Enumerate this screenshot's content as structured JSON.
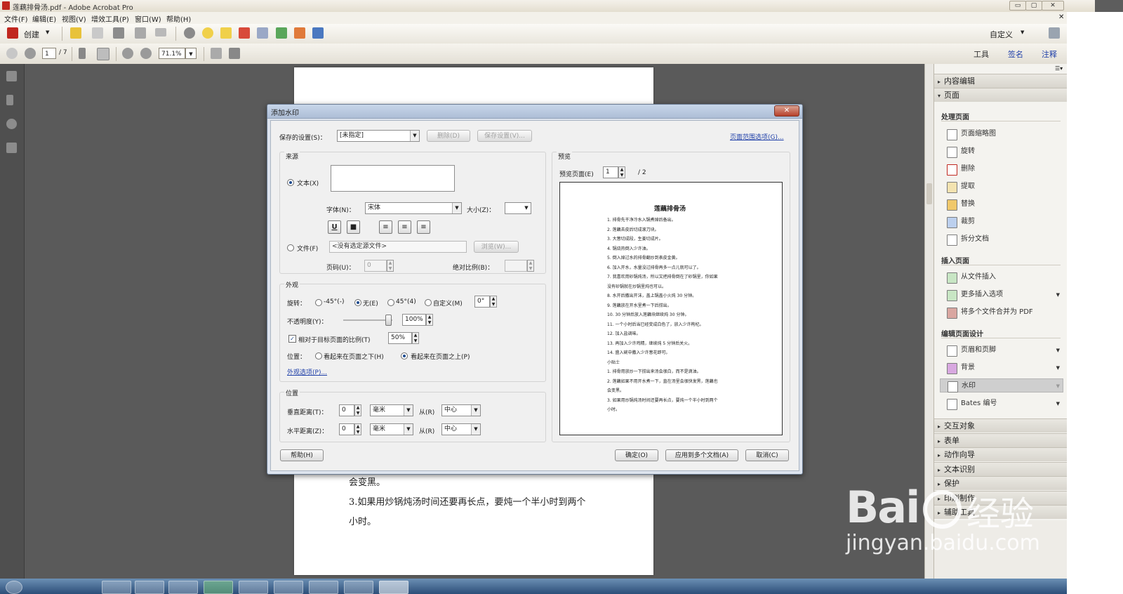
{
  "window": {
    "title": "莲藕排骨汤.pdf - Adobe Acrobat Pro",
    "min": "▭",
    "max": "▢",
    "close": "✕",
    "doc_close": "✕"
  },
  "menu": [
    "文件(F)",
    "编辑(E)",
    "视图(V)",
    "增效工具(P)",
    "窗口(W)",
    "帮助(H)"
  ],
  "toolbar": {
    "create": "创建",
    "customize": "自定义"
  },
  "nav": {
    "page": "1",
    "total": "/ 7",
    "zoom": "71.1%"
  },
  "right_links": {
    "tools": "工具",
    "sign": "签名",
    "comment": "注释"
  },
  "document": {
    "lines": [
      "会变黑。",
      "3.如果用炒锅炖汤时间还要再长点，要炖一个半小时到两个",
      "小时。"
    ]
  },
  "panel": {
    "content_edit": "内容编辑",
    "pages": "页面",
    "process_pages": "处理页面",
    "process_items": [
      "页面缩略图",
      "旋转",
      "删除",
      "提取",
      "替换",
      "裁剪",
      "拆分文档"
    ],
    "insert_pages": "插入页面",
    "insert_items": [
      "从文件插入",
      "更多插入选项",
      "将多个文件合并为 PDF"
    ],
    "design": "编辑页面设计",
    "design_items": [
      "页眉和页脚",
      "背景",
      "水印",
      "Bates 编号"
    ],
    "sections": [
      "交互对象",
      "表单",
      "动作向导",
      "文本识别",
      "保护",
      "印刷制作",
      "辅助工具"
    ]
  },
  "dialog": {
    "title": "添加水印",
    "saved_settings_label": "保存的设置(S)：",
    "saved_settings_value": "[未指定]",
    "delete_btn": "删除(D)",
    "save_settings_btn": "保存设置(V)...",
    "page_range_link": "页面范围选项(G)...",
    "source": {
      "title": "来源",
      "text_label": "文本(X)",
      "font_label": "字体(N)：",
      "font_value": "宋体",
      "size_label": "大小(Z)：",
      "underline": "U",
      "color": "■",
      "align": [
        "≡",
        "≡",
        "≡"
      ],
      "file_label": "文件(F)",
      "file_value": "<没有选定源文件>",
      "browse_btn": "浏览(W)...",
      "page_num_label": "页码(U)：",
      "page_num_value": "0",
      "abs_scale_label": "绝对比例(B)："
    },
    "appearance": {
      "title": "外观",
      "rotation_label": "旋转：",
      "rot_options": [
        "-45°(-)",
        "无(E)",
        "45°(4)",
        "自定义(M)"
      ],
      "rot_custom": "0°",
      "opacity_label": "不透明度(Y)：",
      "opacity_value": "100%",
      "relative_label": "相对于目标页面的比例(T)",
      "relative_value": "50%",
      "position_label": "位置：",
      "pos_behind": "看起来在页面之下(H)",
      "pos_front": "看起来在页面之上(P)",
      "options_link": "外观选项(P)..."
    },
    "position": {
      "title": "位置",
      "vdist_label": "垂直距离(T)：",
      "vdist_value": "0",
      "hdist_label": "水平距离(Z)：",
      "hdist_value": "0",
      "unit": "毫米",
      "from_label": "从(R)",
      "from_value": "中心"
    },
    "preview": {
      "title": "预览",
      "page_label": "预览页面(E)",
      "page_value": "1",
      "total": "/ 2",
      "doc_title": "莲藕排骨汤",
      "lines": [
        "1. 排骨先干净冷水入锅煮焯后备出。",
        "2. 莲藕去皮后切成滚刀块。",
        "3. 大葱切成段，生姜切成片。",
        "4. 锅烧热倒入少许油。",
        "5. 倒入焯过水的排骨翻炒到表皮金黄。",
        "6. 加入开水，水量没过排骨再多一点儿就可以了。",
        "7. 我喜欢用砂锅炖汤，所以又把排骨倒在了砂锅里，你如果",
        "没有砂锅就在炒锅里炖也可以。",
        "8. 水开后撒出开沫，盖上锅盖小火炖 30 分钟。",
        "9. 莲藕放在开水里煮一下后捞出。",
        "10. 30 分钟后放入莲藕块继续炖 30 分钟。",
        "11. 一个小时后当已经变成白色了，放入少许枸杞。",
        "12. 加入盐调味。",
        "13. 再加入少许鸡精，继续炖 5 分钟后关火。",
        "14. 盛入碗中撒入少许葱花即可。",
        "小贴士",
        "1. 排骨用放炒一下捞出来汤会很白，而不是滴油。",
        "2. 莲藕如果不用开水煮一下，直在汤里会很快发黑，莲藕也",
        "会变黑。",
        "3. 如果用炒锅炖汤时间还要再长点，要炖一个半小时到两个",
        "小时。"
      ]
    },
    "help_btn": "帮助(H)",
    "ok_btn": "确定(O)",
    "apply_multi_btn": "应用到多个文档(A)",
    "cancel_btn": "取消(C)"
  },
  "watermark": {
    "brand": "Bai",
    "brand2": "经验",
    "url": "jingyan.baidu.com"
  },
  "colors": {
    "accent": "#1d4a8e",
    "link": "#1f3fa8",
    "pdf_red": "#c0271f"
  }
}
